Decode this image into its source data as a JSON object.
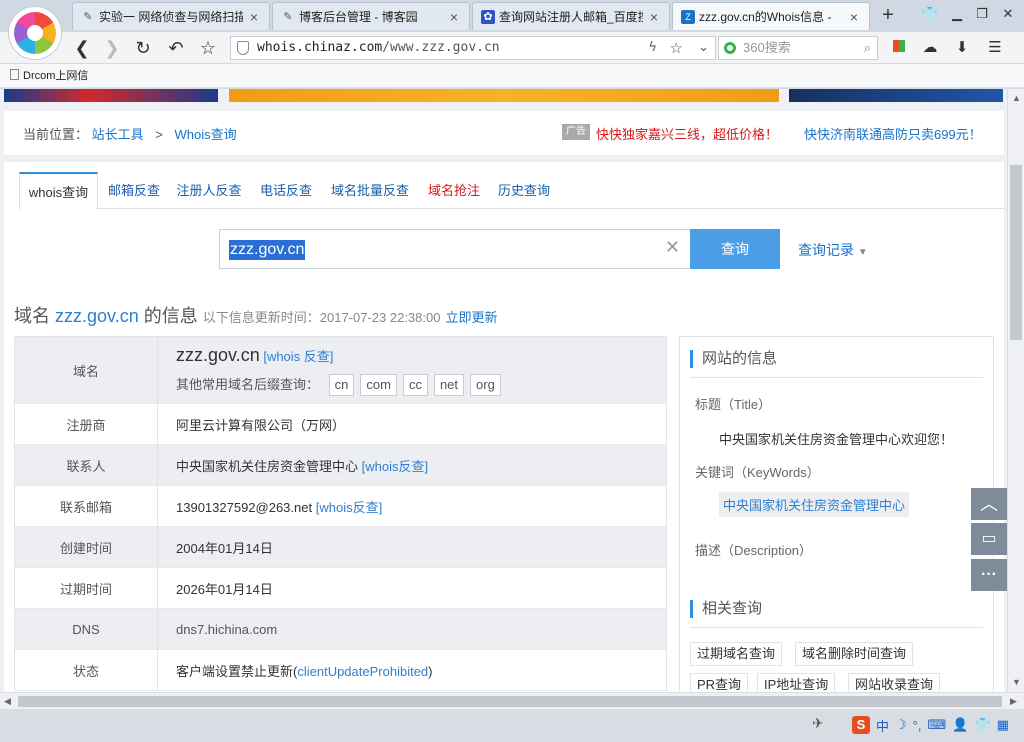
{
  "browser": {
    "tabs": [
      {
        "title": "实验一 网络侦查与网络扫描",
        "active": false
      },
      {
        "title": "博客后台管理 - 博客园",
        "active": false
      },
      {
        "title": "查询网站注册人邮箱_百度搜索",
        "active": false
      },
      {
        "title": "zzz.gov.cn的Whois信息 - ",
        "active": true
      }
    ],
    "new_tab": "+",
    "address": {
      "host": "whois.chinaz.com",
      "path": "/www.zzz.gov.cn"
    },
    "search_placeholder": "360搜索",
    "bookmark": "Drcom上网信"
  },
  "page": {
    "breadcrumb": {
      "prefix": "当前位置：",
      "home": "站长工具",
      "sep": ">",
      "current": "Whois查询"
    },
    "ad_tag": "广告",
    "ads": [
      "快快独家嘉兴三线，超低价格！",
      "快快济南联通高防只卖699元！"
    ],
    "tabs": [
      "whois查询",
      "邮箱反查",
      "注册人反查",
      "电话反查",
      "域名批量反查",
      "域名抢注",
      "历史查询"
    ],
    "search": {
      "value": "zzz.gov.cn",
      "button": "查询",
      "history": "查询记录"
    },
    "info_header": {
      "prefix": "域名 ",
      "domain": "zzz.gov.cn",
      "suffix": " 的信息",
      "update": "以下信息更新时间：2017-07-23 22:38:00",
      "refresh": "立即更新"
    },
    "whois": {
      "domain_label": "域名",
      "domain_value": "zzz.gov.cn",
      "domain_link": "[whois 反查]",
      "suffix_label": "其他常用域名后缀查询：",
      "suffixes": [
        "cn",
        "com",
        "cc",
        "net",
        "org"
      ],
      "rows": [
        {
          "key": "注册商",
          "value": "阿里云计算有限公司（万网）",
          "link": ""
        },
        {
          "key": "联系人",
          "value": "中央国家机关住房资金管理中心",
          "link": "[whois反查]"
        },
        {
          "key": "联系邮箱",
          "value": "13901327592@263.net",
          "link": "[whois反查]"
        },
        {
          "key": "创建时间",
          "value": "2004年01月14日",
          "link": ""
        },
        {
          "key": "过期时间",
          "value": "2026年01月14日",
          "link": ""
        },
        {
          "key": "DNS",
          "value": "dns7.hichina.com",
          "link": ""
        },
        {
          "key": "状态",
          "value": "客户端设置禁止更新(",
          "link": "clientUpdateProhibited",
          "tail": ")"
        }
      ]
    },
    "sidebar": {
      "site_info_title": "网站的信息",
      "title_label": "标题（Title）",
      "title_value": "中央国家机关住房资金管理中心欢迎您！",
      "keywords_label": "关键词（KeyWords）",
      "keywords_value": "中央国家机关住房资金管理中心",
      "description_label": "描述（Description）",
      "related_title": "相关查询",
      "related": [
        "过期域名查询",
        "域名删除时间查询",
        "PR查询",
        "IP地址查询",
        "网站收录查询"
      ]
    }
  },
  "ime": {
    "mode": "中"
  },
  "colors": {
    "link": "#1a73c9",
    "accent": "#4b9ee6",
    "red": "#d2181c"
  }
}
